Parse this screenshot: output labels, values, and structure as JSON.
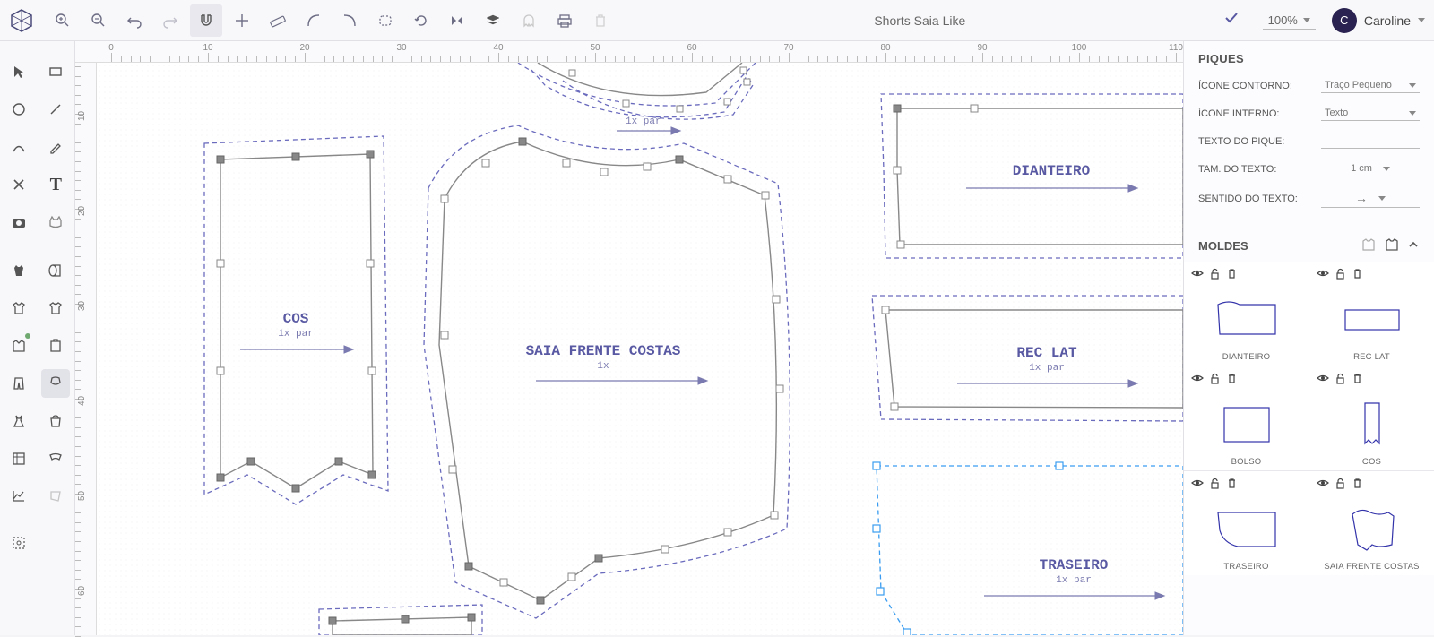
{
  "header": {
    "doc_title": "Shorts Saia Like",
    "zoom": "100%",
    "user_name": "Caroline",
    "user_initial": "C"
  },
  "piques": {
    "title": "PIQUES",
    "icone_contorno_label": "ÍCONE CONTORNO:",
    "icone_contorno_value": "Traço Pequeno",
    "icone_interno_label": "ÍCONE INTERNO:",
    "icone_interno_value": "Texto",
    "texto_pique_label": "TEXTO DO PIQUE:",
    "texto_pique_value": "",
    "tam_texto_label": "TAM. DO TEXTO:",
    "tam_texto_value": "1 cm",
    "sentido_label": "SENTIDO DO TEXTO:",
    "sentido_value": "→"
  },
  "moldes": {
    "title": "MOLDES",
    "items": [
      {
        "name": "DIANTEIRO"
      },
      {
        "name": "REC LAT"
      },
      {
        "name": "BOLSO"
      },
      {
        "name": "COS"
      },
      {
        "name": "TRASEIRO"
      },
      {
        "name": "SAIA FRENTE COSTAS"
      }
    ]
  },
  "pieces": {
    "cos": {
      "title": "COS",
      "sub": "1x par"
    },
    "saia": {
      "title": "SAIA FRENTE COSTAS",
      "sub": "1x"
    },
    "dianteiro": {
      "title": "DIANTEIRO",
      "sub": ""
    },
    "reclat": {
      "title": "REC LAT",
      "sub": "1x par"
    },
    "traseiro": {
      "title": "TRASEIRO",
      "sub": "1x par"
    }
  },
  "ruler_h": [
    0,
    10,
    20,
    30,
    40,
    50,
    60,
    70,
    80,
    90,
    100,
    110
  ],
  "ruler_v": [
    10,
    20,
    30,
    40,
    50,
    60
  ]
}
